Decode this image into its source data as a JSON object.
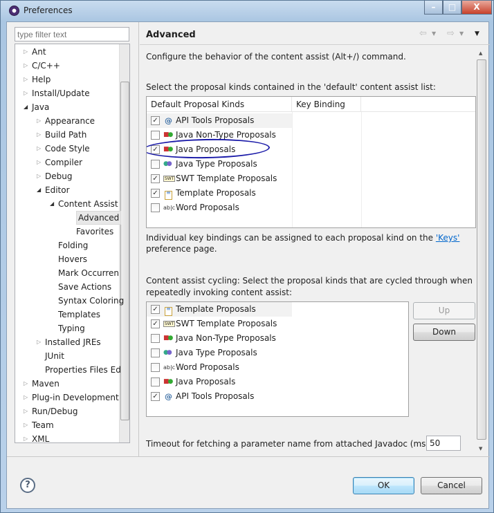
{
  "window": {
    "title": "Preferences"
  },
  "left": {
    "filter_placeholder": "type filter text",
    "tree": [
      {
        "label": "Ant",
        "level": 0,
        "arrow": "collapsed"
      },
      {
        "label": "C/C++",
        "level": 0,
        "arrow": "collapsed"
      },
      {
        "label": "Help",
        "level": 0,
        "arrow": "collapsed"
      },
      {
        "label": "Install/Update",
        "level": 0,
        "arrow": "collapsed"
      },
      {
        "label": "Java",
        "level": 0,
        "arrow": "expanded"
      },
      {
        "label": "Appearance",
        "level": 1,
        "arrow": "collapsed"
      },
      {
        "label": "Build Path",
        "level": 1,
        "arrow": "collapsed"
      },
      {
        "label": "Code Style",
        "level": 1,
        "arrow": "collapsed"
      },
      {
        "label": "Compiler",
        "level": 1,
        "arrow": "collapsed"
      },
      {
        "label": "Debug",
        "level": 1,
        "arrow": "collapsed"
      },
      {
        "label": "Editor",
        "level": 1,
        "arrow": "expanded"
      },
      {
        "label": "Content Assist",
        "level": 2,
        "arrow": "expanded"
      },
      {
        "label": "Advanced",
        "level": 3,
        "arrow": "none",
        "selected": true
      },
      {
        "label": "Favorites",
        "level": 3,
        "arrow": "none"
      },
      {
        "label": "Folding",
        "level": 2,
        "arrow": "none"
      },
      {
        "label": "Hovers",
        "level": 2,
        "arrow": "none"
      },
      {
        "label": "Mark Occurren",
        "level": 2,
        "arrow": "none"
      },
      {
        "label": "Save Actions",
        "level": 2,
        "arrow": "none"
      },
      {
        "label": "Syntax Coloring",
        "level": 2,
        "arrow": "none"
      },
      {
        "label": "Templates",
        "level": 2,
        "arrow": "none"
      },
      {
        "label": "Typing",
        "level": 2,
        "arrow": "none"
      },
      {
        "label": "Installed JREs",
        "level": 1,
        "arrow": "collapsed"
      },
      {
        "label": "JUnit",
        "level": 1,
        "arrow": "none"
      },
      {
        "label": "Properties Files Ed",
        "level": 1,
        "arrow": "none"
      },
      {
        "label": "Maven",
        "level": 0,
        "arrow": "collapsed"
      },
      {
        "label": "Plug-in Development",
        "level": 0,
        "arrow": "collapsed"
      },
      {
        "label": "Run/Debug",
        "level": 0,
        "arrow": "collapsed"
      },
      {
        "label": "Team",
        "level": 0,
        "arrow": "collapsed"
      },
      {
        "label": "XML",
        "level": 0,
        "arrow": "collapsed"
      }
    ]
  },
  "page": {
    "title": "Advanced",
    "description": "Configure the behavior of the content assist (Alt+/) command.",
    "default_label": "Select the proposal kinds contained in the 'default' content assist list:",
    "columns": [
      "Default Proposal Kinds",
      "Key Binding"
    ],
    "default_list": [
      {
        "label": "API Tools Proposals",
        "checked": true,
        "icon": "api-tools"
      },
      {
        "label": "Java Non-Type Proposals",
        "checked": false,
        "icon": "java-shapes"
      },
      {
        "label": "Java Proposals",
        "checked": true,
        "icon": "java-shapes",
        "annotated": true
      },
      {
        "label": "Java Type Proposals",
        "checked": false,
        "icon": "java-type"
      },
      {
        "label": "SWT Template Proposals",
        "checked": true,
        "icon": "swt"
      },
      {
        "label": "Template Proposals",
        "checked": true,
        "icon": "template"
      },
      {
        "label": "Word Proposals",
        "checked": false,
        "icon": "word"
      }
    ],
    "keys_text_before": "Individual key bindings can be assigned to each proposal kind on the ",
    "keys_link": "'Keys'",
    "keys_text_after": "preference page.",
    "cycling_label_1": "Content assist cycling: Select the proposal kinds that are cycled through when",
    "cycling_label_2": "repeatedly invoking content assist:",
    "cycling_list": [
      {
        "label": "Template Proposals",
        "checked": true,
        "icon": "template"
      },
      {
        "label": "SWT Template Proposals",
        "checked": true,
        "icon": "swt"
      },
      {
        "label": "Java Non-Type Proposals",
        "checked": false,
        "icon": "java-shapes"
      },
      {
        "label": "Java Type Proposals",
        "checked": false,
        "icon": "java-type"
      },
      {
        "label": "Word Proposals",
        "checked": false,
        "icon": "word"
      },
      {
        "label": "Java Proposals",
        "checked": false,
        "icon": "java-shapes"
      },
      {
        "label": "API Tools Proposals",
        "checked": true,
        "icon": "api-tools"
      }
    ],
    "up_label": "Up",
    "down_label": "Down",
    "timeout_label": "Timeout for fetching a parameter name from attached Javadoc (ms):",
    "timeout_value": "50"
  },
  "footer": {
    "ok_label": "OK",
    "cancel_label": "Cancel",
    "help": "?"
  },
  "colors": {
    "annotation": "#1a1aa8",
    "link": "#0066cc",
    "selection": "#e8e8e8"
  }
}
